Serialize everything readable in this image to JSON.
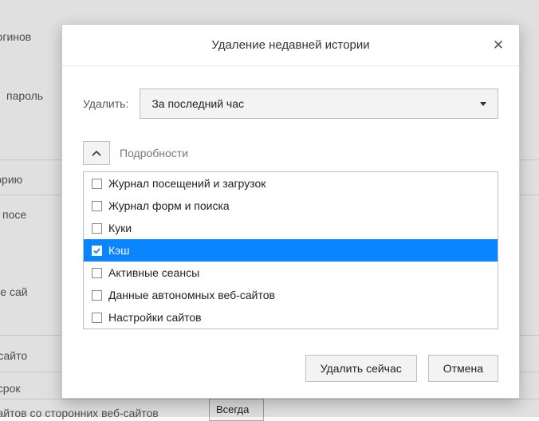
{
  "backdrop": {
    "line_logins": "ние логинов",
    "line_password": "пароль",
    "line_history": "ь историю",
    "line_visited": "рию посе",
    "line_sites": "анные сай",
    "line_sites2": "ные сайто",
    "line_expiry": "ения срок",
    "line_third_party": "ные сайтов со сторонних веб-сайтов",
    "select_always": "Всегда"
  },
  "dialog": {
    "title": "Удаление недавней истории",
    "delete_label": "Удалить:",
    "range_selected": "За последний час",
    "details_label": "Подробности",
    "options": [
      {
        "label": "Журнал посещений и загрузок",
        "checked": false,
        "selected": false
      },
      {
        "label": "Журнал форм и поиска",
        "checked": false,
        "selected": false
      },
      {
        "label": "Куки",
        "checked": false,
        "selected": false
      },
      {
        "label": "Кэш",
        "checked": true,
        "selected": true
      },
      {
        "label": "Активные сеансы",
        "checked": false,
        "selected": false
      },
      {
        "label": "Данные автономных веб-сайтов",
        "checked": false,
        "selected": false
      },
      {
        "label": "Настройки сайтов",
        "checked": false,
        "selected": false
      }
    ],
    "buttons": {
      "ok": "Удалить сейчас",
      "cancel": "Отмена"
    }
  }
}
